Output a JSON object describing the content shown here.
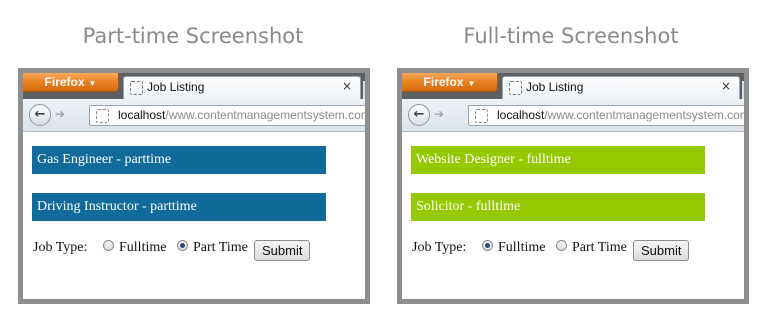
{
  "captions": {
    "left": "Part-time Screenshot",
    "right": "Full-time Screenshot"
  },
  "browser": {
    "firefox_label": "Firefox",
    "tab_title": "Job Listing",
    "tab_close": "×",
    "url_host": "localhost",
    "url_path": "/www.contentmanagementsystem.com"
  },
  "panels": [
    {
      "jobs": [
        "Gas Engineer - parttime",
        "Driving Instructor - parttime"
      ],
      "job_color": "#106a9a",
      "selected": "Part Time"
    },
    {
      "jobs": [
        "Website Designer - fulltime",
        "Solicitor - fulltime"
      ],
      "job_color": "#95c901",
      "selected": "Fulltime"
    }
  ],
  "form": {
    "job_type_label": "Job Type:",
    "option_fulltime": "Fulltime",
    "option_parttime": "Part Time",
    "submit_label": "Submit"
  }
}
